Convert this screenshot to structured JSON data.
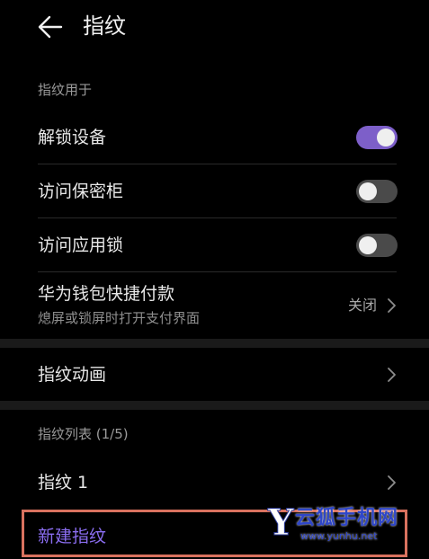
{
  "header": {
    "title": "指纹",
    "back_icon": "arrow-left-icon"
  },
  "sections": {
    "usage_label": "指纹用于",
    "list_label": "指纹列表 (1/5)"
  },
  "usage_items": [
    {
      "label": "解锁设备",
      "toggle": true
    },
    {
      "label": "访问保密柜",
      "toggle": false
    },
    {
      "label": "访问应用锁",
      "toggle": false
    }
  ],
  "wallet": {
    "label": "华为钱包快捷付款",
    "subtitle": "熄屏或锁屏时打开支付界面",
    "value": "关闭"
  },
  "animation": {
    "label": "指纹动画"
  },
  "fingerprints": [
    {
      "label": "指纹 1"
    }
  ],
  "add": {
    "label": "新建指纹"
  },
  "watermark": {
    "letter": "Y",
    "text": "云狐手机网",
    "url": "www.yunhu.net"
  },
  "colors": {
    "background": "#000000",
    "accent": "#7d5fc9",
    "highlight_border": "#d9725f",
    "add_text": "#8a6df0",
    "band": "#1a1a1a"
  }
}
